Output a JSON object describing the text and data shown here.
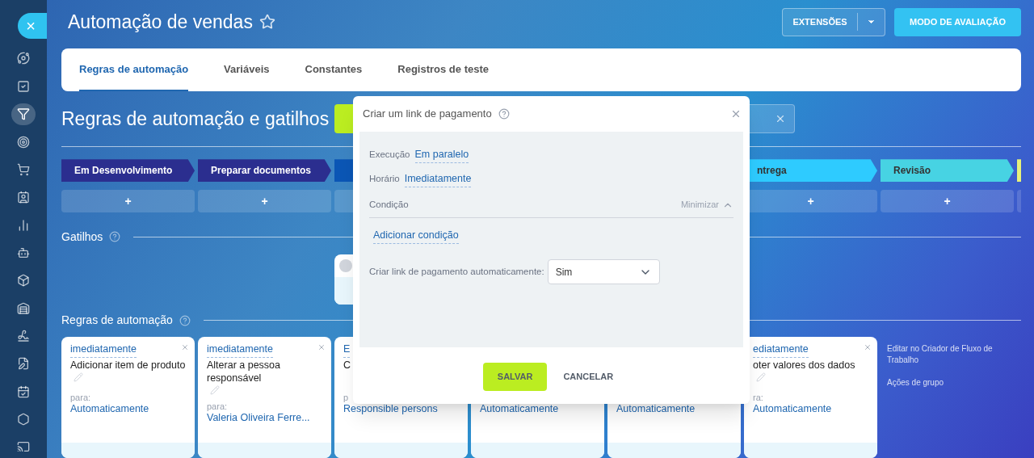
{
  "sidebar": {
    "close": "×",
    "items": [
      {
        "selected": false
      },
      {
        "selected": false
      },
      {
        "selected": true
      },
      {
        "selected": false
      },
      {
        "selected": false
      },
      {
        "selected": false
      },
      {
        "selected": false
      },
      {
        "selected": false
      },
      {
        "selected": false
      },
      {
        "selected": false
      },
      {
        "selected": false
      },
      {
        "selected": false
      },
      {
        "selected": false
      },
      {
        "selected": false
      },
      {
        "selected": false
      }
    ]
  },
  "header": {
    "title": "Automação de vendas",
    "starred": false,
    "extensions": "EXTENSÕES",
    "trial": "MODO DE AVALIAÇÃO"
  },
  "tabs": [
    {
      "label": "Regras de automação",
      "selected": true
    },
    {
      "label": "Variáveis",
      "selected": false
    },
    {
      "label": "Constantes",
      "selected": false
    },
    {
      "label": "Registros de teste",
      "selected": false
    }
  ],
  "section_title": "Regras de automação e gatilhos",
  "stages": [
    {
      "label": "Em Desenvolvimento",
      "color": "#2b2e8f"
    },
    {
      "label": "Preparar documentos",
      "color": "#2b2e8f"
    },
    {
      "color": "#0b56b5"
    },
    {
      "label": "ntrega",
      "color": "#2ecbff"
    },
    {
      "label": "Revisão",
      "color": "#47d3e3"
    },
    {
      "color": "#e6f07a"
    }
  ],
  "add_buttons": [
    "+",
    "+",
    "+",
    "+"
  ],
  "triggers_title": "Gatilhos",
  "rules_title": "Regras de automação",
  "cards": [
    {
      "timing": "imediatamente",
      "title": "Adicionar item de produto",
      "for_label": "para:",
      "target": "Automaticamente",
      "closable": true
    },
    {
      "timing": "imediatamente",
      "title": "Alterar a pessoa responsável",
      "for_label": "para:",
      "target": "Valeria Oliveira Ferre...",
      "closable": true
    },
    {
      "timing": "E",
      "title": "C",
      "for_label": "p",
      "target": "Responsible persons"
    },
    {
      "target": "Automaticamente"
    },
    {
      "target": "Automaticamente"
    },
    {
      "timing": "ediatamente",
      "title": "oter valores dos dados",
      "for_label": "ra:",
      "target": "Automaticamente",
      "closable": true
    }
  ],
  "side_links": [
    "Editar no Criador de Fluxo de Trabalho",
    "Ações de grupo"
  ],
  "dialog": {
    "title": "Criar um link de pagamento",
    "fields": [
      {
        "label": "Execução",
        "value": "Em paralelo"
      },
      {
        "label": "Horário",
        "value": "Imediatamente"
      }
    ],
    "condition": {
      "label": "Condição",
      "toggle": "Minimizar",
      "expanded": true,
      "add": "Adicionar condição"
    },
    "option": {
      "label": "Criar link de pagamento automaticamente:",
      "value": "Sim"
    },
    "save": "SALVAR",
    "cancel": "CANCELAR"
  }
}
